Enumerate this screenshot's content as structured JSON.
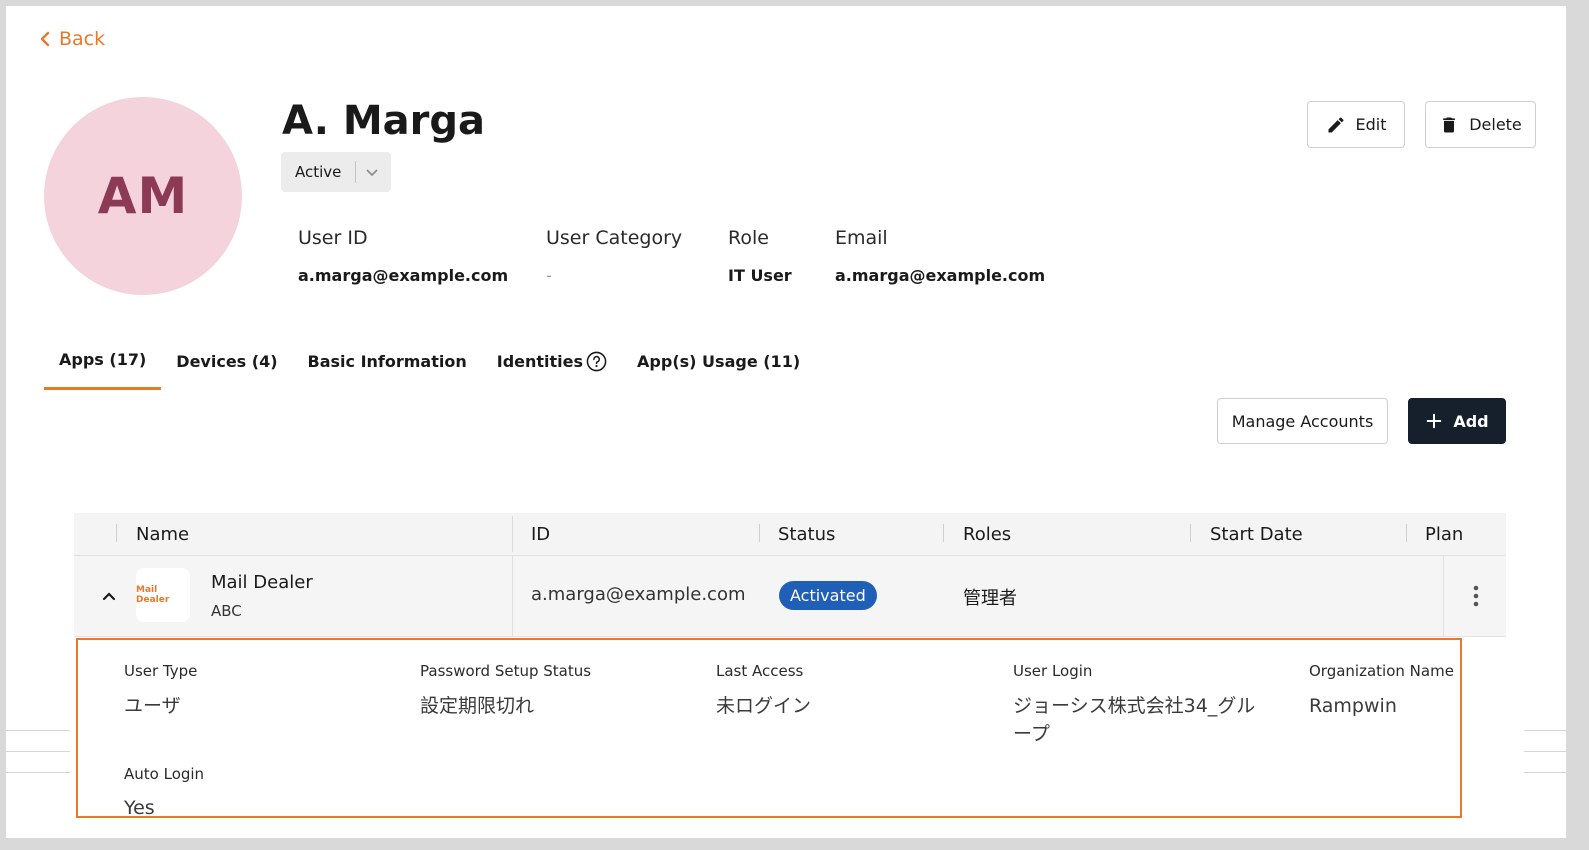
{
  "nav": {
    "back_label": "Back"
  },
  "profile": {
    "initials": "AM",
    "name": "A. Marga",
    "status": "Active",
    "edit_label": "Edit",
    "delete_label": "Delete",
    "fields": [
      {
        "label": "User ID",
        "value": "a.marga@example.com"
      },
      {
        "label": "User Category",
        "value": "-"
      },
      {
        "label": "Role",
        "value": "IT User"
      },
      {
        "label": "Email",
        "value": "a.marga@example.com"
      }
    ]
  },
  "tabs": [
    {
      "label": "Apps (17)",
      "active": true
    },
    {
      "label": "Devices (4)"
    },
    {
      "label": "Basic Information"
    },
    {
      "label": "Identities"
    },
    {
      "label": "App(s) Usage (11)"
    }
  ],
  "actions": {
    "manage_label": "Manage Accounts",
    "add_label": "Add"
  },
  "table": {
    "columns": [
      "Name",
      "ID",
      "Status",
      "Roles",
      "Start Date",
      "Plan"
    ],
    "rows": [
      {
        "app_name": "Mail Dealer",
        "app_sub": "ABC",
        "logo_text": "Mail Dealer",
        "id": "a.marga@example.com",
        "status": "Activated",
        "roles": "管理者",
        "start_date": "",
        "plan": ""
      }
    ]
  },
  "details": {
    "fields": [
      {
        "label": "User Type",
        "value": "ユーザ"
      },
      {
        "label": "Password Setup Status",
        "value": "設定期限切れ"
      },
      {
        "label": "Last Access",
        "value": "未ログイン"
      },
      {
        "label": "User Login",
        "value": "ジョーシス株式会社34_グループ"
      },
      {
        "label": "Organization Name",
        "value": "Rampwin"
      },
      {
        "label": "Auto Login",
        "value": "Yes"
      }
    ]
  },
  "colors": {
    "accent": "#e8792a",
    "primary_dark": "#16202d",
    "status_blue": "#1f5fb8",
    "avatar_bg": "#f4d3dd",
    "avatar_fg": "#8c3a56"
  }
}
